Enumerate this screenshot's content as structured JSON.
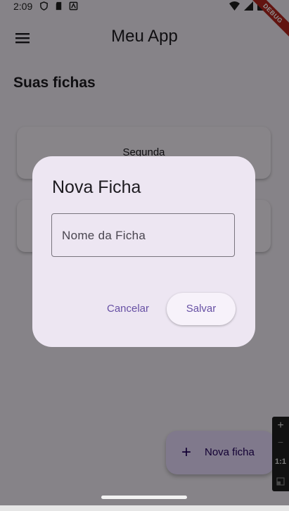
{
  "status_bar": {
    "time": "2:09",
    "left_icons": [
      "shield-icon",
      "sd-card-icon",
      "android-icon"
    ],
    "right_icons": [
      "wifi-icon",
      "signal-icon",
      "battery-icon"
    ]
  },
  "debug_banner": {
    "label": "DEBUG"
  },
  "app_bar": {
    "title": "Meu App",
    "menu_icon": "hamburger-menu-icon"
  },
  "main": {
    "section_title": "Suas fichas",
    "cards": [
      {
        "label": "Segunda"
      },
      {
        "label": ""
      }
    ]
  },
  "fab": {
    "icon": "plus-icon",
    "label": "Nova ficha"
  },
  "zoom_panel": {
    "plus": "+",
    "minus": "−",
    "ratio": "1:1"
  },
  "dialog": {
    "title": "Nova Ficha",
    "input": {
      "placeholder": "Nome da Ficha",
      "value": ""
    },
    "cancel_label": "Cancelar",
    "save_label": "Salvar"
  },
  "colors": {
    "primary": "#6750a4",
    "dialog_surface": "#ede6f2",
    "fab_container": "#eaddff",
    "debug_banner": "#b3261e"
  }
}
